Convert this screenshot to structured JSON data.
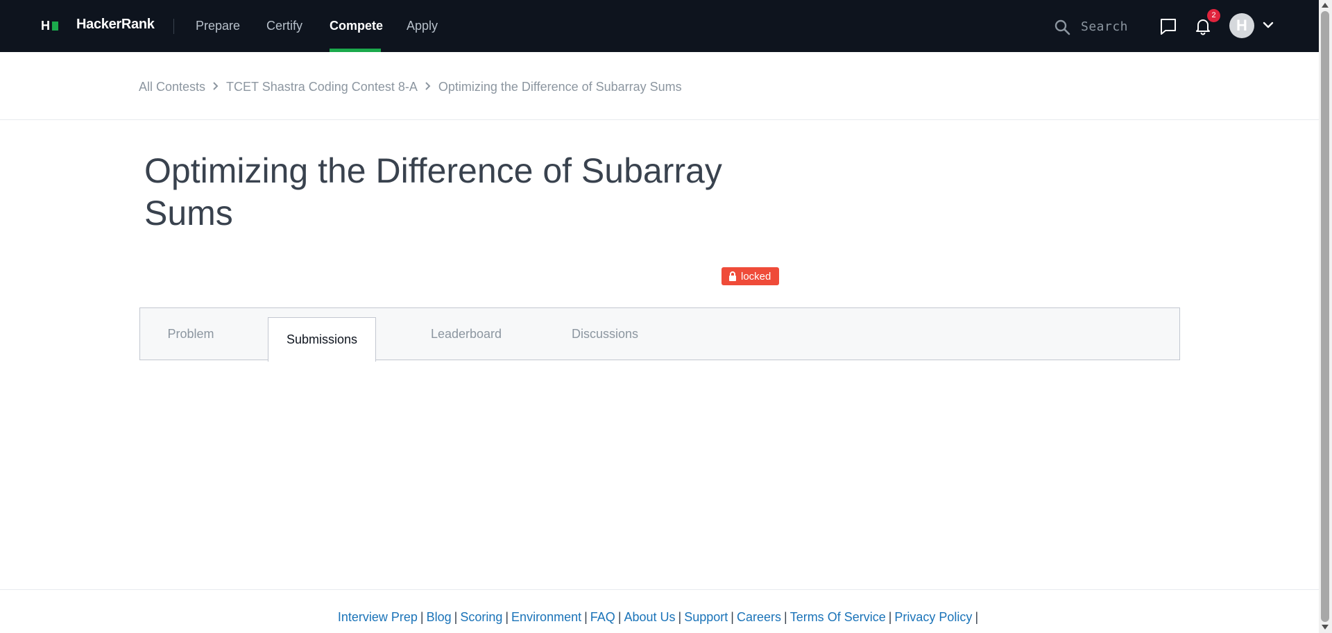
{
  "nav": {
    "logo_letter": "H",
    "brand": "HackerRank",
    "items": [
      {
        "label": "Prepare",
        "active": false
      },
      {
        "label": "Certify",
        "active": false
      },
      {
        "label": "Compete",
        "active": true
      },
      {
        "label": "Apply",
        "active": false
      }
    ],
    "search_placeholder": "Search",
    "notification_count": "2",
    "avatar_initial": "H",
    "icons": [
      "search-icon",
      "message-icon",
      "bell-icon",
      "chevron-down-icon"
    ]
  },
  "breadcrumb": {
    "items": [
      "All Contests",
      "TCET Shastra Coding Contest 8-A",
      "Optimizing the Difference of Subarray Sums"
    ]
  },
  "challenge": {
    "title": "Optimizing the Difference of Subarray Sums",
    "status": "locked"
  },
  "tabs": [
    {
      "label": "Problem",
      "active": false
    },
    {
      "label": "Submissions",
      "active": true
    },
    {
      "label": "Leaderboard",
      "active": false
    },
    {
      "label": "Discussions",
      "active": false
    }
  ],
  "footer": {
    "links": [
      "Interview Prep",
      "Blog",
      "Scoring",
      "Environment",
      "FAQ",
      "About Us",
      "Support",
      "Careers",
      "Terms Of Service",
      "Privacy Policy"
    ]
  },
  "colors": {
    "nav_bg": "#0e141e",
    "accent": "#1ba94c",
    "locked": "#ef4b39",
    "link": "#1a73b8"
  }
}
